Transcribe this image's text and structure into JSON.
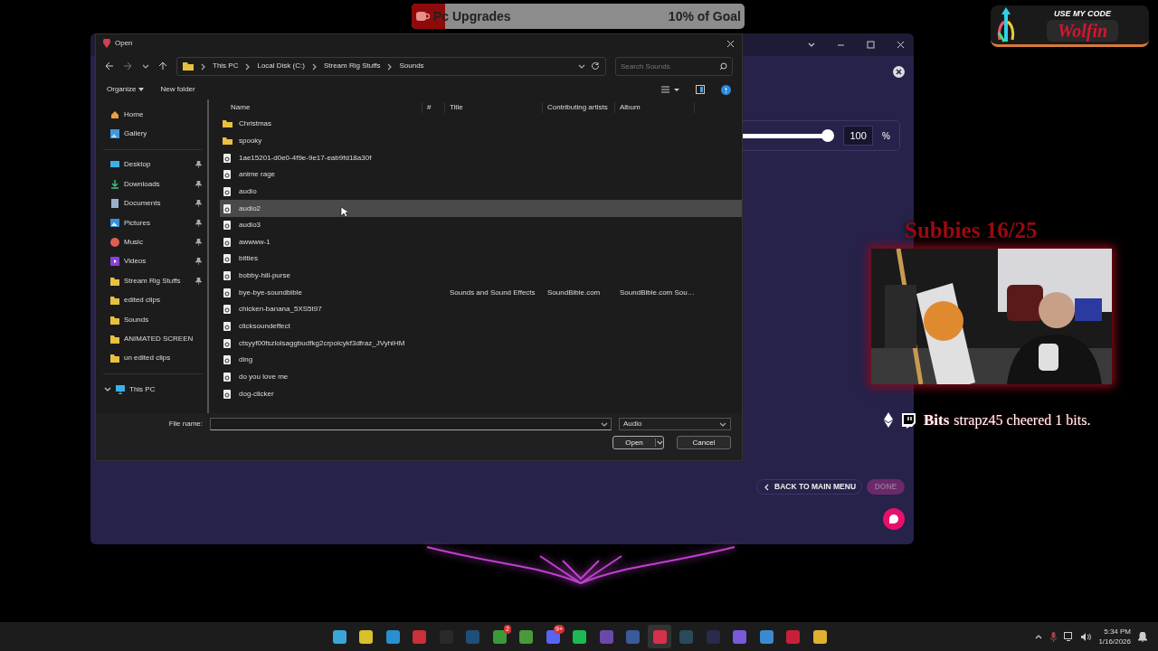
{
  "goal_bar": {
    "label": "Pc Upgrades",
    "progress": "10% of Goal",
    "level": 0.1
  },
  "promo": {
    "line1": "USE MY CODE",
    "code": "Wolfin"
  },
  "background_app": {
    "volume": {
      "level": 1,
      "value": "100",
      "unit": "%"
    },
    "back_button": "BACK TO MAIN MENU",
    "done_button": {
      "label": "DONE",
      "disabled": true
    }
  },
  "dialog": {
    "title": "Open",
    "breadcrumb": [
      "This PC",
      "Local Disk (C:)",
      "Stream Rig Stuffs",
      "Sounds"
    ],
    "search": {
      "placeholder": "Search Sounds"
    },
    "toolbar": [
      "Organize",
      "New folder"
    ],
    "sidebar": {
      "sections": [
        {
          "items": [
            {
              "label": "Home",
              "kind": "home",
              "pinned": false
            },
            {
              "label": "Gallery",
              "kind": "gallery",
              "pinned": false
            }
          ]
        },
        {
          "items": [
            {
              "label": "Desktop",
              "kind": "desktop",
              "pinned": true
            },
            {
              "label": "Downloads",
              "kind": "downloads",
              "pinned": true
            },
            {
              "label": "Documents",
              "kind": "documents",
              "pinned": true
            },
            {
              "label": "Pictures",
              "kind": "pictures",
              "pinned": true
            },
            {
              "label": "Music",
              "kind": "music",
              "pinned": true
            },
            {
              "label": "Videos",
              "kind": "videos",
              "pinned": true
            },
            {
              "label": "Stream Rig Stuffs",
              "kind": "folder",
              "pinned": true
            },
            {
              "label": "edited clips",
              "kind": "folder",
              "pinned": false
            },
            {
              "label": "Sounds",
              "kind": "folder",
              "pinned": false
            },
            {
              "label": "ANIMATED SCREEN",
              "kind": "folder",
              "pinned": false
            },
            {
              "label": "un edited clips",
              "kind": "folder",
              "pinned": false
            }
          ]
        },
        {
          "items": [
            {
              "label": "This PC",
              "kind": "pc",
              "pinned": false,
              "expanded": true
            }
          ]
        }
      ]
    },
    "columns": [
      "Name",
      "#",
      "Title",
      "Contributing artists",
      "Album"
    ],
    "rows": [
      {
        "name": "Christmas",
        "kind": "folder",
        "selected": false
      },
      {
        "name": "spooky",
        "kind": "folder",
        "selected": false
      },
      {
        "name": "1ae15201-d0e0-4f9e-9e17-eab9fd18a30f",
        "kind": "audio",
        "selected": false
      },
      {
        "name": "anime rage",
        "kind": "audio",
        "selected": false
      },
      {
        "name": "audio",
        "kind": "audio",
        "selected": false
      },
      {
        "name": "audio2",
        "kind": "audio",
        "selected": true
      },
      {
        "name": "audio3",
        "kind": "audio",
        "selected": false
      },
      {
        "name": "awwww-1",
        "kind": "audio",
        "selected": false
      },
      {
        "name": "bitties",
        "kind": "audio",
        "selected": false
      },
      {
        "name": "bobby-hill-purse",
        "kind": "audio",
        "selected": false
      },
      {
        "name": "bye-bye-soundbible",
        "kind": "audio",
        "selected": false,
        "title": "Sounds and Sound Effects",
        "artists": "SoundBible.com",
        "album": "SoundBible.com Sou…"
      },
      {
        "name": "chicken-banana_5XS5t97",
        "kind": "audio",
        "selected": false
      },
      {
        "name": "clicksoundeffect",
        "kind": "audio",
        "selected": false
      },
      {
        "name": "ctsyyf00fszlolsaggbudfkg2crpolcykf3dfraz_JVyhiHM",
        "kind": "audio",
        "selected": false
      },
      {
        "name": "ding",
        "kind": "audio",
        "selected": false
      },
      {
        "name": "do you love me",
        "kind": "audio",
        "selected": false
      },
      {
        "name": "dog-clicker",
        "kind": "audio",
        "selected": false
      }
    ],
    "file_name_label": "File name:",
    "file_type": "Audio",
    "open_button": "Open",
    "cancel_button": "Cancel"
  },
  "overlay": {
    "subs_goal": "Subbies 16/25",
    "alert_title": "Bits",
    "alert_message": "strapz45 cheered 1 bits."
  },
  "taskbar": {
    "apps": [
      {
        "color": "#3aa6d8",
        "active": false
      },
      {
        "color": "#d8c12a",
        "active": false
      },
      {
        "color": "#2a8fd0",
        "active": false
      },
      {
        "color": "#c8303a",
        "active": false
      },
      {
        "color": "#2a2a2a",
        "active": false
      },
      {
        "color": "#1f4f78",
        "active": false
      },
      {
        "color": "#3a9a3a",
        "active": false,
        "badge": "2"
      },
      {
        "color": "#4a9a3a",
        "active": false
      },
      {
        "color": "#5865f2",
        "active": false,
        "badge": "9+"
      },
      {
        "color": "#1db954",
        "active": false
      },
      {
        "color": "#6a4aa8",
        "active": false
      },
      {
        "color": "#3a5a9a",
        "active": false
      },
      {
        "color": "#d8304a",
        "active": true
      },
      {
        "color": "#2a4a5a",
        "active": false
      },
      {
        "color": "#2a2a4a",
        "active": false
      },
      {
        "color": "#7a5ad8",
        "active": false
      },
      {
        "color": "#3a8ad0",
        "active": false
      },
      {
        "color": "#c8203a",
        "active": false
      },
      {
        "color": "#e0b030",
        "active": false
      }
    ],
    "time": "5:34 PM",
    "date": "1/16/2026"
  }
}
